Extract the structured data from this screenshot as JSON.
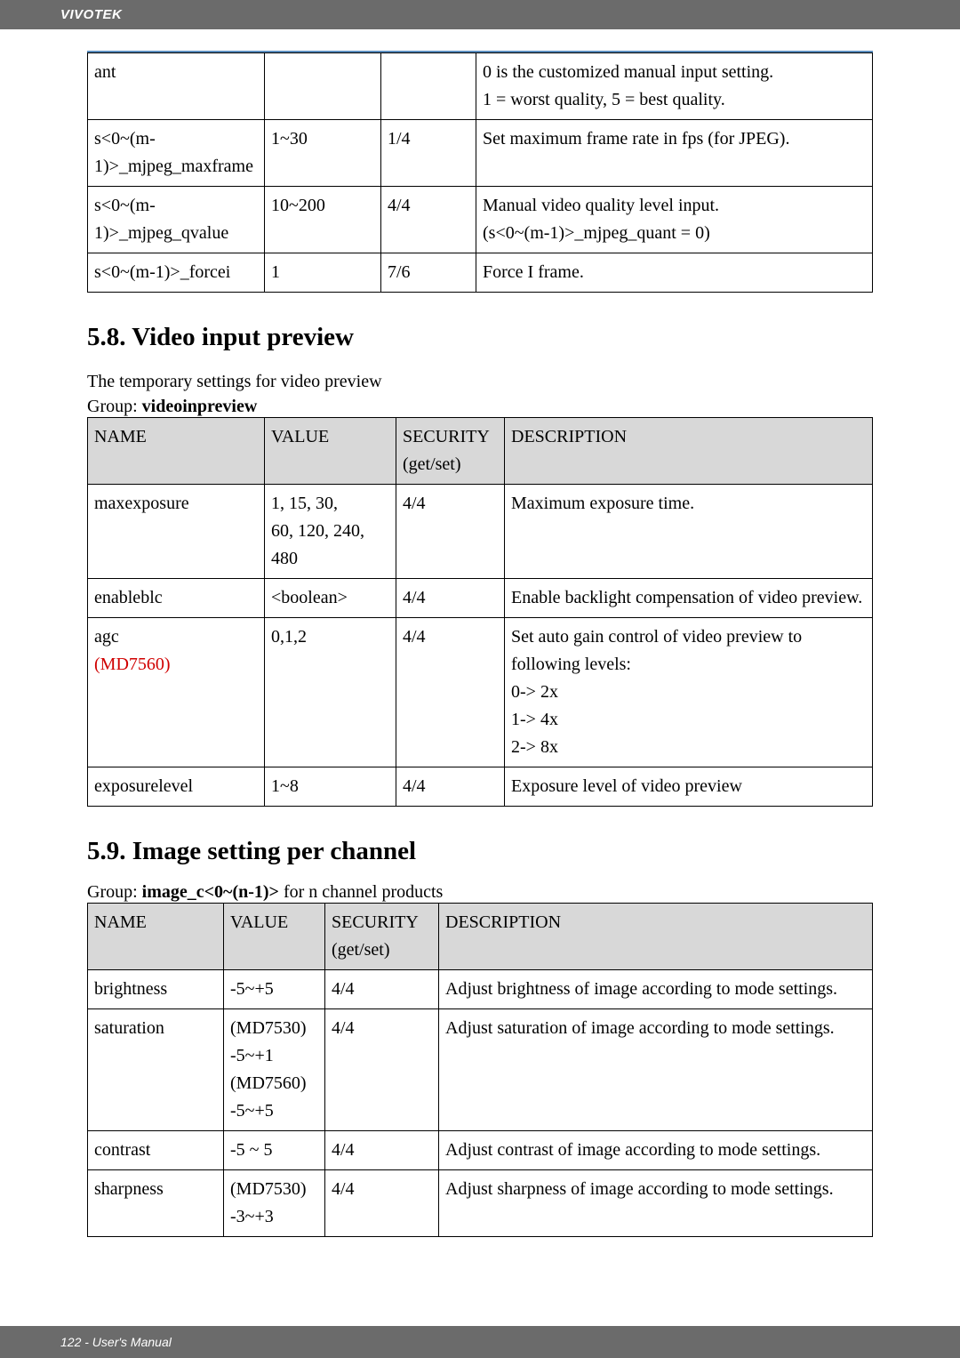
{
  "header": {
    "brand": "VIVOTEK"
  },
  "table1": {
    "rows": [
      {
        "c1": "ant",
        "c2": "",
        "c3": "",
        "c4": "0 is the customized manual input setting.\n1 = worst quality, 5 = best quality."
      },
      {
        "c1": "s<0~(m-1)>_mjpeg_maxframe",
        "c2": "1~30",
        "c3": "1/4",
        "c4": "Set maximum frame rate in fps (for JPEG)."
      },
      {
        "c1": "s<0~(m-1)>_mjpeg_qvalue",
        "c2": "10~200",
        "c3": "4/4",
        "c4": "Manual video quality level input.\n(s<0~(m-1)>_mjpeg_quant = 0)"
      },
      {
        "c1": "s<0~(m-1)>_forcei",
        "c2": "1",
        "c3": "7/6",
        "c4": "Force I frame."
      }
    ]
  },
  "section58": {
    "heading": "5.8. Video input preview",
    "intro": "The temporary settings for video preview",
    "group_label": "Group: ",
    "group_name": "videoinpreview",
    "headers": {
      "name": "NAME",
      "value": "VALUE",
      "security": "SECURITY\n(get/set)",
      "description": "DESCRIPTION"
    },
    "rows": [
      {
        "name": "maxexposure",
        "value": "1, 15, 30,\n60, 120, 240,\n480",
        "security": "4/4",
        "description": "Maximum exposure time."
      },
      {
        "name": "enableblc",
        "value": "<boolean>",
        "security": "4/4",
        "description": "Enable backlight compensation of video preview."
      },
      {
        "name_parts": [
          {
            "text": "agc"
          },
          {
            "text": "(MD7560)",
            "red": true
          }
        ],
        "value": "0,1,2",
        "security": "4/4",
        "description": "Set auto gain control of video preview to following levels:\n0-> 2x\n1-> 4x\n2-> 8x"
      },
      {
        "name": "exposurelevel",
        "value": "1~8",
        "security": "4/4",
        "description": "Exposure level of video preview"
      }
    ]
  },
  "section59": {
    "heading": "5.9. Image setting per channel",
    "group_label": "Group: ",
    "group_name": "image_c<0~(n-1)>",
    "group_suffix": " for n channel products",
    "headers": {
      "name": "NAME",
      "value": "VALUE",
      "security": "SECURITY\n(get/set)",
      "description": "DESCRIPTION"
    },
    "rows": [
      {
        "name": "brightness",
        "value": "-5~+5",
        "security": "4/4",
        "description": "Adjust brightness of image according to mode settings."
      },
      {
        "name": "saturation",
        "value": "(MD7530)\n-5~+1\n(MD7560)\n-5~+5",
        "security": "4/4",
        "description": "Adjust saturation of image according to mode settings."
      },
      {
        "name": "contrast",
        "value": "-5 ~ 5",
        "security": "4/4",
        "description": "Adjust contrast of image according to mode settings."
      },
      {
        "name": "sharpness",
        "value": "(MD7530)\n-3~+3",
        "security": "4/4",
        "description": "Adjust sharpness of image according to mode settings."
      }
    ]
  },
  "footer": {
    "text": "122 - User's Manual"
  }
}
